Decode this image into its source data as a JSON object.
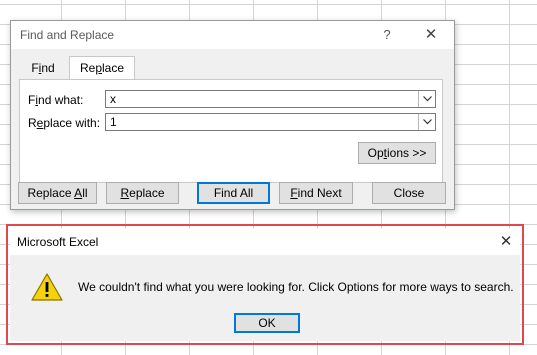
{
  "find_replace": {
    "title": "Find and Replace",
    "help_glyph": "?",
    "close_glyph": "✕",
    "tabs": [
      {
        "pre": "F",
        "ul": "i",
        "post": "nd"
      },
      {
        "pre": "Re",
        "ul": "p",
        "post": "lace"
      }
    ],
    "find_what": {
      "pre": "F",
      "ul": "i",
      "post": "nd what:",
      "value": "x"
    },
    "replace_with": {
      "pre": "R",
      "ul": "e",
      "post": "place with:",
      "value": "1"
    },
    "buttons": {
      "options": {
        "pre": "Op",
        "ul": "t",
        "post": "ions >>"
      },
      "replace_all": {
        "pre": "Replace ",
        "ul": "A",
        "post": "ll"
      },
      "replace": {
        "pre": "",
        "ul": "R",
        "post": "eplace"
      },
      "find_all": {
        "pre": "Find A",
        "ul": "",
        "post": "ll",
        "full": "Find All"
      },
      "find_next": {
        "pre": "",
        "ul": "F",
        "post": "ind Next"
      },
      "close": {
        "pre": "Close",
        "ul": "",
        "post": ""
      }
    }
  },
  "message_box": {
    "title": "Microsoft Excel",
    "close_glyph": "✕",
    "message": "We couldn't find what you were looking for. Click Options for more ways to search.",
    "ok_label": "OK",
    "icon": "warning-icon"
  },
  "colors": {
    "highlight_border": "#e0484e",
    "default_button_border": "#0078d7",
    "warning_fill": "#f5d20c"
  }
}
